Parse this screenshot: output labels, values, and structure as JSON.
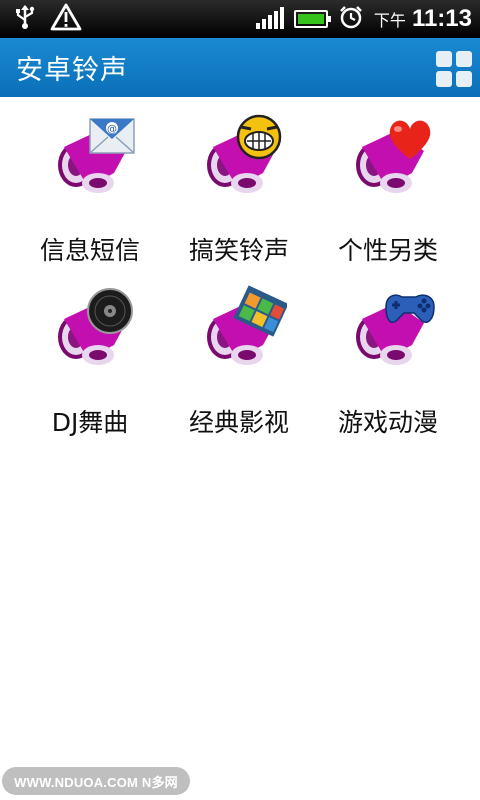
{
  "status_bar": {
    "icons": [
      "usb-icon",
      "warning-icon",
      "signal-icon",
      "battery-icon",
      "alarm-icon"
    ],
    "ampm": "下午",
    "time": "11:13",
    "battery_color": "#36c21c"
  },
  "header": {
    "title": "安卓铃声",
    "menu_icon": "grid-icon",
    "bg_color": "#0e7ec6"
  },
  "categories": [
    {
      "label": "信息短信",
      "icon": "mail-speaker-icon"
    },
    {
      "label": "搞笑铃声",
      "icon": "laughing-face-speaker-icon"
    },
    {
      "label": "个性另类",
      "icon": "heart-speaker-icon"
    },
    {
      "label": "DJ舞曲",
      "icon": "record-speaker-icon"
    },
    {
      "label": "经典影视",
      "icon": "film-speaker-icon"
    },
    {
      "label": "游戏动漫",
      "icon": "gamepad-speaker-icon"
    }
  ],
  "watermark": "WWW.NDUOA.COM N多网"
}
